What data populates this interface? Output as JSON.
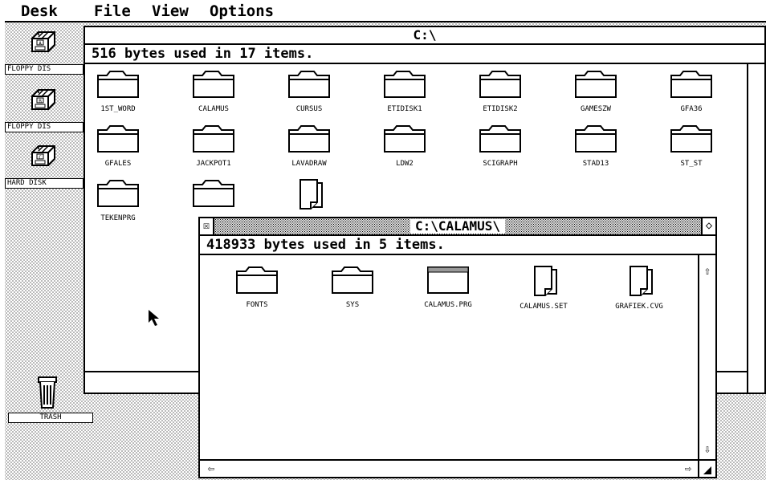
{
  "menubar": {
    "items": [
      "Desk",
      "File",
      "View",
      "Options"
    ]
  },
  "desktop": {
    "icons": [
      {
        "label": "FLOPPY DIS",
        "letter": "A"
      },
      {
        "label": "FLOPPY DIS",
        "letter": "B"
      },
      {
        "label": "HARD DISK",
        "letter": "C"
      },
      {
        "label": "TRASH"
      }
    ]
  },
  "root_window": {
    "title": "C:\\",
    "info": "516 bytes used in 17 items.",
    "items": [
      {
        "name": "1ST_WORD",
        "kind": "folder"
      },
      {
        "name": "CALAMUS",
        "kind": "folder"
      },
      {
        "name": "CURSUS",
        "kind": "folder"
      },
      {
        "name": "ETIDISK1",
        "kind": "folder"
      },
      {
        "name": "ETIDISK2",
        "kind": "folder"
      },
      {
        "name": "GAMESZW",
        "kind": "folder"
      },
      {
        "name": "GFA36",
        "kind": "folder"
      },
      {
        "name": "GFALES",
        "kind": "folder"
      },
      {
        "name": "JACKPOT1",
        "kind": "folder"
      },
      {
        "name": "LAVADRAW",
        "kind": "folder"
      },
      {
        "name": "LDW2",
        "kind": "folder"
      },
      {
        "name": "SCIGRAPH",
        "kind": "folder"
      },
      {
        "name": "STAD13",
        "kind": "folder"
      },
      {
        "name": "ST_ST",
        "kind": "folder"
      },
      {
        "name": "TEKENPRG",
        "kind": "folder"
      },
      {
        "name": "",
        "kind": "folder"
      },
      {
        "name": "",
        "kind": "document"
      }
    ]
  },
  "calamus_window": {
    "title": "C:\\CALAMUS\\",
    "info": "418933 bytes used in 5 items.",
    "close_glyph": "☒",
    "full_glyph": "◇",
    "scroll_up_glyph": "⇧",
    "scroll_down_glyph": "⇩",
    "scroll_left_glyph": "⇦",
    "scroll_right_glyph": "⇨",
    "items": [
      {
        "name": "FONTS",
        "kind": "folder"
      },
      {
        "name": "SYS",
        "kind": "folder"
      },
      {
        "name": "CALAMUS.PRG",
        "kind": "program"
      },
      {
        "name": "CALAMUS.SET",
        "kind": "document"
      },
      {
        "name": "GRAFIEK.CVG",
        "kind": "document"
      }
    ]
  },
  "icons": [
    "drive-icon",
    "trash-icon",
    "folder-icon",
    "document-icon",
    "program-icon",
    "pointer-icon"
  ]
}
